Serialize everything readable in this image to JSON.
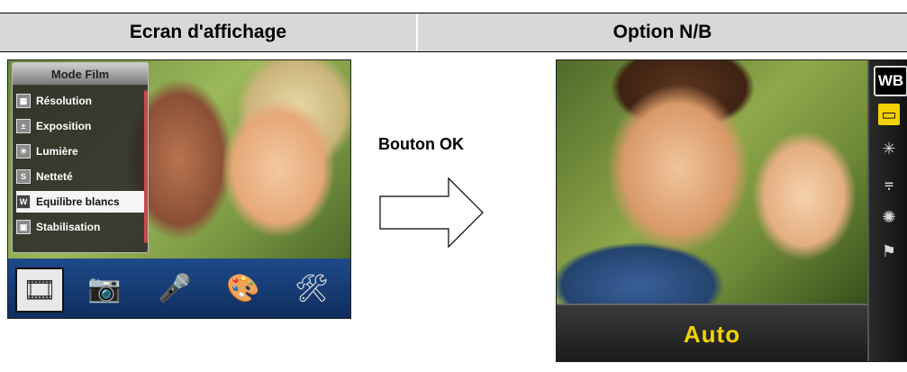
{
  "header": {
    "left_title": "Ecran d'affichage",
    "right_title": "Option N/B"
  },
  "left_screen": {
    "menu_title": "Mode Film",
    "menu_items": [
      {
        "label": "Résolution",
        "icon": "resolution-icon"
      },
      {
        "label": "Exposition",
        "icon": "exposure-icon"
      },
      {
        "label": "Lumière",
        "icon": "light-icon"
      },
      {
        "label": "Netteté",
        "icon": "sharpness-icon"
      },
      {
        "label": "Equilibre blancs",
        "icon": "white-balance-icon",
        "selected": true
      },
      {
        "label": "Stabilisation",
        "icon": "stabilization-icon"
      }
    ],
    "mode_icons": [
      "film-mode-icon",
      "camera-mode-icon",
      "voice-mode-icon",
      "effects-mode-icon",
      "settings-mode-icon"
    ]
  },
  "arrow_label": "Bouton OK",
  "right_screen": {
    "wb_badge": "WB",
    "value": "Auto",
    "side_icons": [
      "auto-wb-icon",
      "daylight-icon",
      "fluorescent-icon",
      "tungsten-icon",
      "cloudy-icon"
    ]
  }
}
